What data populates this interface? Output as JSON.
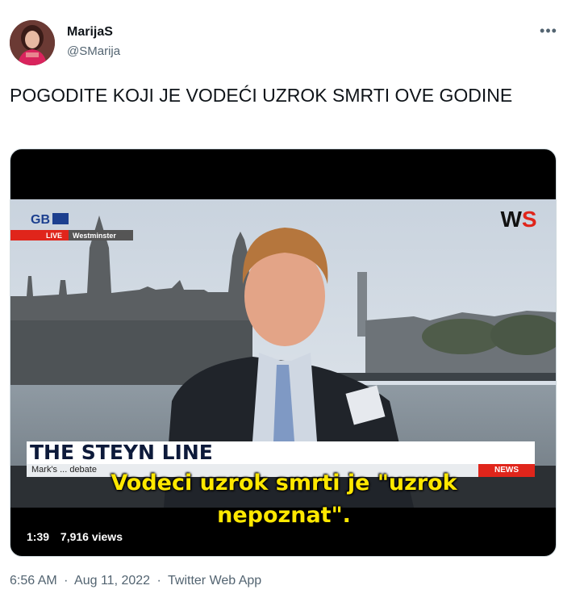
{
  "tweet": {
    "author_name": "MarijaS",
    "author_handle": "@SMarija",
    "text": "POGODITE KOJI JE VODEĆI UZROK SMRTI OVE GODINE",
    "more_icon": "more-horizontal-icon"
  },
  "video": {
    "channel_logo": "GB NEWS",
    "live_label": "LIVE",
    "location_label": "Westminster",
    "watermark": "WS",
    "show_title": "THE STEYN LINE",
    "ticker_text": "Mark's ... debate",
    "news_badge": "NEWS",
    "subtitle_line1": "Vodeci uzrok smrti je \"uzrok",
    "subtitle_line2": "nepoznat\".",
    "duration": "1:39",
    "views": "7,916 views"
  },
  "footer": {
    "time": "6:56 AM",
    "date": "Aug 11, 2022",
    "source": "Twitter Web App",
    "separator": "·"
  },
  "colors": {
    "text_primary": "#0f1419",
    "text_secondary": "#536471",
    "subtitle": "#ffe800",
    "live_red": "#e0251b"
  }
}
